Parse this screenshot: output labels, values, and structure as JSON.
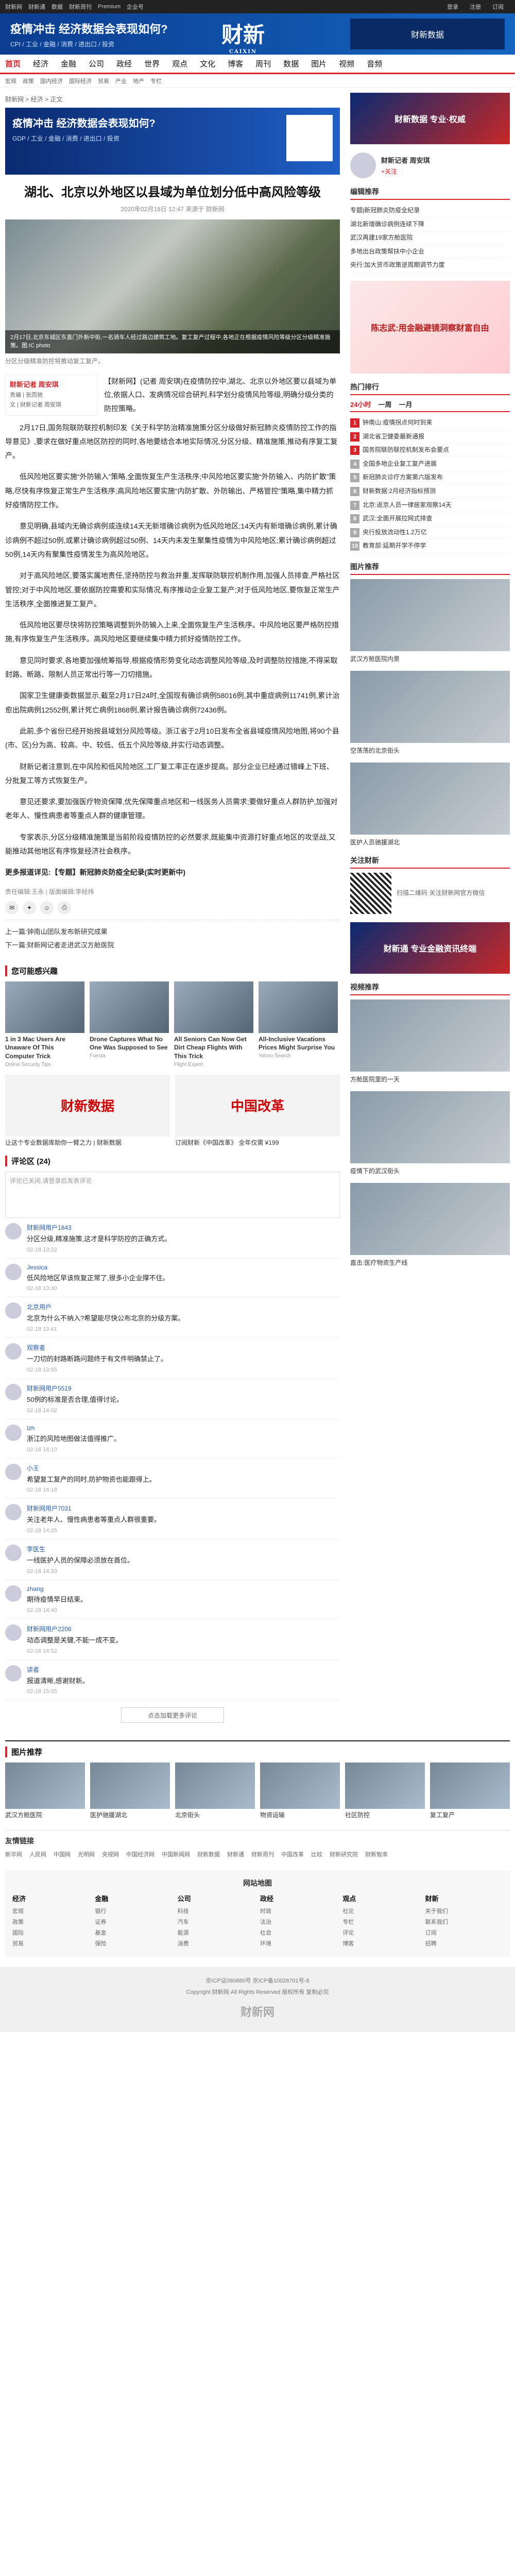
{
  "topbar": {
    "items": [
      "财新网",
      "财新通",
      "数据",
      "财新周刊",
      "Premium",
      "企业号"
    ],
    "right": [
      "登录",
      "注册",
      "订阅"
    ]
  },
  "banner": {
    "title": "疫情冲击 经济数据会表现如何?",
    "subtitle": "CPI / 工业 / 金融 / 消费 / 进出口 / 投资",
    "brand": "财新",
    "brand_sub": "CAIXIN",
    "ad": "财新数据"
  },
  "nav": [
    "首页",
    "经济",
    "金融",
    "公司",
    "政经",
    "世界",
    "观点",
    "文化",
    "博客",
    "周刊",
    "数据",
    "图片",
    "视频",
    "音频"
  ],
  "subnav": [
    "宏观",
    "政策",
    "国内经济",
    "国际经济",
    "贸易",
    "产业",
    "地产",
    "专栏"
  ],
  "crumb": "财新网 > 经济 > 正文",
  "hero": {
    "title": "疫情冲击 经济数据会表现如何?",
    "subtitle": "GDP / 工业 / 金融 / 消费 / 进出口 / 投资"
  },
  "article": {
    "title": "湖北、北京以外地区以县域为单位划分低中高风险等级",
    "meta": "2020年02月18日 12:47 来源于 财新网",
    "photo_caption": "2月17日,北京东城区东直门外新中街,一名骑车人经过路边建筑工地。复工复产过程中,各地正在根据疫情风险等级分区分级精准施策。图:IC photo",
    "caption": "分区分级精准防控将推动复工复产。",
    "author_name": "财新记者 周安琪",
    "author_box": [
      "责编 | 张而驰",
      "文 | 财新记者 周安琪"
    ],
    "lead": "【财新网】(记者 周安琪)在疫情防控中,湖北、北京以外地区要以县域为单位,依据人口、发病情况综合研判,科学划分疫情风险等级,明确分级分类的防控策略。",
    "paragraphs": [
      "2月17日,国务院联防联控机制印发《关于科学防治精准施策分区分级做好新冠肺炎疫情防控工作的指导意见》,要求在做好重点地区防控的同时,各地要结合本地实际情况,分区分级、精准施策,推动有序复工复产。",
      "低风险地区要实施“外防输入”策略,全面恢复生产生活秩序;中风险地区要实施“外防输入、内防扩散”策略,尽快有序恢复正常生产生活秩序;高风险地区要实施“内防扩散、外防输出、严格管控”策略,集中精力抓好疫情防控工作。",
      "意见明确,县域内无确诊病例或连续14天无新增确诊病例为低风险地区;14天内有新增确诊病例,累计确诊病例不超过50例,或累计确诊病例超过50例、14天内未发生聚集性疫情为中风险地区;累计确诊病例超过50例,14天内有聚集性疫情发生为高风险地区。",
      "对于高风险地区,要落实属地责任,坚持防控与救治并重,发挥联防联控机制作用,加强人员排查,严格社区管控;对于中风险地区,要依据防控需要和实际情况,有序推动企业复工复产;对于低风险地区,要恢复正常生产生活秩序,全面推进复工复产。",
      "低风险地区要尽快将防控策略调整到外防输入上来,全面恢复生产生活秩序。中风险地区要严格防控措施,有序恢复生产生活秩序。高风险地区要继续集中精力抓好疫情防控工作。",
      "意见同时要求,各地要加强统筹指导,根据疫情形势变化动态调整风险等级,及时调整防控措施,不得采取封路、断路、限制人员正常出行等一刀切措施。",
      "国家卫生健康委数据显示,截至2月17日24时,全国现有确诊病例58016例,其中重症病例11741例,累计治愈出院病例12552例,累计死亡病例1868例,累计报告确诊病例72436例。",
      "此前,多个省份已经开始按县域划分风险等级。浙江省于2月10日发布全省县域疫情风险地图,将90个县(市、区)分为高、较高、中、较低、低五个风险等级,并实行动态调整。",
      "财新记者注意到,在中风险和低风险地区,工厂复工率正在逐步提高。部分企业已经通过错峰上下班、分批复工等方式恢复生产。",
      "意见还要求,要加强医疗物资保障,优先保障重点地区和一线医务人员需求;要做好重点人群防护,加强对老年人、慢性病患者等重点人群的健康管理。",
      "专家表示,分区分级精准施策是当前阶段疫情防控的必然要求,既能集中资源打好重点地区的攻坚战,又能推动其他地区有序恢复经济社会秩序。"
    ],
    "bold_line": "更多报道详见:【专题】新冠肺炎防疫全纪录(实时更新中)",
    "editor": "责任编辑:王永 | 版面编辑:李经纬",
    "prev": "上一篇:钟南山团队发布新研究成果",
    "next": "下一篇:财新网记者走进武汉方舱医院"
  },
  "sponsored": {
    "title": "您可能感兴趣",
    "items": [
      {
        "title": "1 in 3 Mac Users Are Unaware Of This Computer Trick",
        "sponsor": "Online Security Tips"
      },
      {
        "title": "Drone Captures What No One Was Supposed to See",
        "sponsor": "Fuesta"
      },
      {
        "title": "All Seniors Can Now Get Dirt Cheap Flights With This Trick",
        "sponsor": "Flight Expert"
      },
      {
        "title": "All-Inclusive Vacations Prices Might Surprise You",
        "sponsor": "Yahoo Search"
      }
    ],
    "duo": [
      {
        "title": "让这个专业数据库助你一臂之力 | 财新数据",
        "img": "财新数据"
      },
      {
        "title": "订阅财新《中国改革》 全年仅需 ¥199",
        "img": "中国改革"
      }
    ]
  },
  "comment": {
    "title": "评论区 (24)",
    "placeholder": "评论已关闭,请登录后发表评论",
    "items": [
      {
        "name": "财新网用户1843",
        "text": "分区分级,精准施策,这才是科学防控的正确方式。",
        "date": "02-18 13:22"
      },
      {
        "name": "Jessica",
        "text": "低风险地区早该恢复正常了,很多小企业撑不住。",
        "date": "02-18 13:30"
      },
      {
        "name": "北京用户",
        "text": "北京为什么不纳入?希望能尽快公布北京的分级方案。",
        "date": "02-18 13:41"
      },
      {
        "name": "观察者",
        "text": "一刀切的封路断路问题终于有文件明确禁止了。",
        "date": "02-18 13:55"
      },
      {
        "name": "财新网用户5519",
        "text": "50例的标准是否合理,值得讨论。",
        "date": "02-18 14:02"
      },
      {
        "name": "lzh",
        "text": "浙江的风险地图做法值得推广。",
        "date": "02-18 14:10"
      },
      {
        "name": "小王",
        "text": "希望复工复产的同时,防护物资也能跟得上。",
        "date": "02-18 14:18"
      },
      {
        "name": "财新网用户7031",
        "text": "关注老年人、慢性病患者等重点人群很重要。",
        "date": "02-18 14:25"
      },
      {
        "name": "李医生",
        "text": "一线医护人员的保障必须放在首位。",
        "date": "02-18 14:33"
      },
      {
        "name": "zhang",
        "text": "期待疫情早日结束。",
        "date": "02-18 14:40"
      },
      {
        "name": "财新网用户2206",
        "text": "动态调整是关键,不能一成不变。",
        "date": "02-18 14:52"
      },
      {
        "name": "读者",
        "text": "报道清晰,感谢财新。",
        "date": "02-18 15:05"
      }
    ],
    "more": "点击加载更多评论"
  },
  "sidebar": {
    "ad1": "财新数据 专业·权威",
    "author": {
      "name": "财新记者 周安琪",
      "follow": "+关注"
    },
    "hot_title": "编辑推荐",
    "hot": [
      "专题|新冠肺炎防疫全纪录",
      "湖北新增确诊病例连续下降",
      "武汉再建19家方舱医院",
      "多地出台政策帮扶中小企业",
      "央行:加大货币政策逆周期调节力度"
    ],
    "ad2": "陈志武:用金融避镜洞察财富自由",
    "rank_title": "热门排行",
    "rank_tabs": [
      "24小时",
      "一周",
      "一月"
    ],
    "rank": [
      "钟南山:疫情拐点何时到来",
      "湖北省卫健委最新通报",
      "国务院联防联控机制发布会要点",
      "全国多地企业复工复产进展",
      "新冠肺炎诊疗方案第六版发布",
      "财新数据:2月经济指标预测",
      "北京:返京人员一律居家观察14天",
      "武汉:全面开展拉网式排查",
      "央行投放流动性1.2万亿",
      "教育部:延期开学不停学"
    ],
    "pic_title": "图片推荐",
    "pics": [
      "武汉方舱医院内景",
      "空荡荡的北京街头",
      "医护人员驰援湖北"
    ],
    "follow_title": "关注财新",
    "follow_text": "扫描二维码 关注财新网官方微信",
    "ad3": "财新通 专业金融资讯终端",
    "video_title": "视频推荐",
    "videos": [
      "方舱医院里的一天",
      "疫情下的武汉街头",
      "直击:医疗物资生产线"
    ]
  },
  "recent": {
    "title": "图片推荐",
    "items": [
      "武汉方舱医院",
      "医护驰援湖北",
      "北京街头",
      "物资运输",
      "社区防控",
      "复工复产"
    ]
  },
  "links": {
    "title": "友情链接",
    "items": [
      "新华网",
      "人民网",
      "中国网",
      "光明网",
      "央视网",
      "中国经济网",
      "中国新闻网",
      "财新数据",
      "财新通",
      "财新周刊",
      "中国改革",
      "比较",
      "财新研究院",
      "财新智库"
    ]
  },
  "sitemap": {
    "title": "网站地图",
    "cols": [
      {
        "h": "经济",
        "items": [
          "宏观",
          "政策",
          "国际",
          "贸易"
        ]
      },
      {
        "h": "金融",
        "items": [
          "银行",
          "证券",
          "基金",
          "保险"
        ]
      },
      {
        "h": "公司",
        "items": [
          "科技",
          "汽车",
          "能源",
          "消费"
        ]
      },
      {
        "h": "政经",
        "items": [
          "时政",
          "法治",
          "社会",
          "环境"
        ]
      },
      {
        "h": "观点",
        "items": [
          "社论",
          "专栏",
          "评论",
          "博客"
        ]
      },
      {
        "h": "财新",
        "items": [
          "关于我们",
          "联系我们",
          "订阅",
          "招聘"
        ]
      }
    ]
  },
  "footer": {
    "lines": [
      "京ICP证090880号 京ICP备10026701号-8",
      "Copyright 财新网 All Rights Reserved 版权所有 复制必究"
    ],
    "logo": "财新网"
  }
}
